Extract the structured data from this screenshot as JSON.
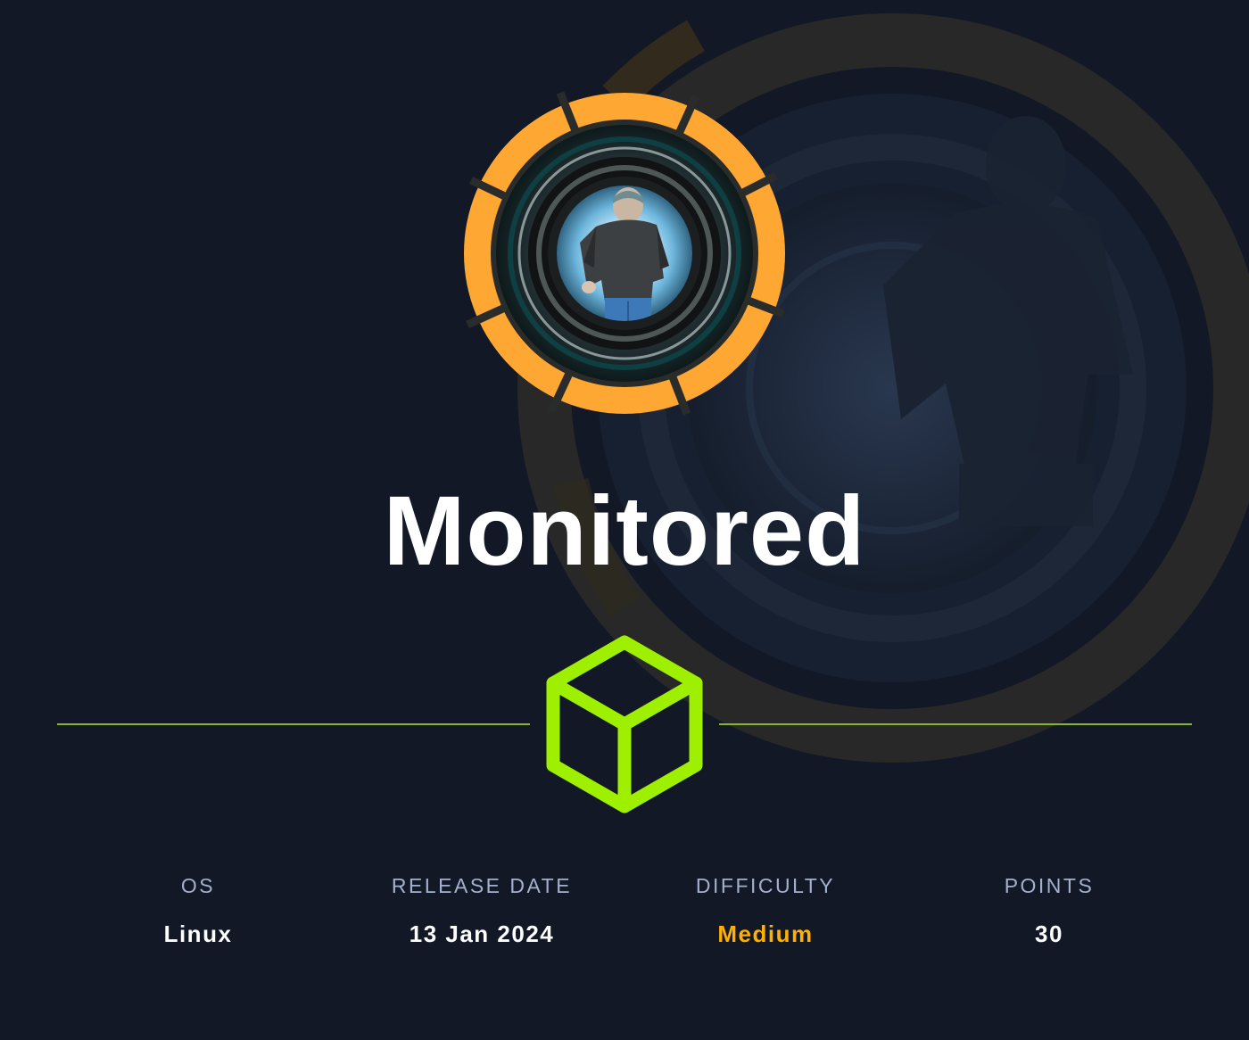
{
  "machine": {
    "name": "Monitored"
  },
  "stats": {
    "os": {
      "label": "OS",
      "value": "Linux"
    },
    "release_date": {
      "label": "RELEASE DATE",
      "value": "13 Jan 2024"
    },
    "difficulty": {
      "label": "DIFFICULTY",
      "value": "Medium"
    },
    "points": {
      "label": "POINTS",
      "value": "30"
    }
  },
  "colors": {
    "background": "#121826",
    "accent_green": "#9fef00",
    "rule_green": "#86b52b",
    "difficulty_medium": "#ffaf00",
    "label_gray": "#a4b1cd",
    "logo_ring_orange": "#ffa733"
  },
  "icons": {
    "machine_logo": "camera-lens-avatar-icon",
    "platform": "hackthebox-cube-icon"
  }
}
